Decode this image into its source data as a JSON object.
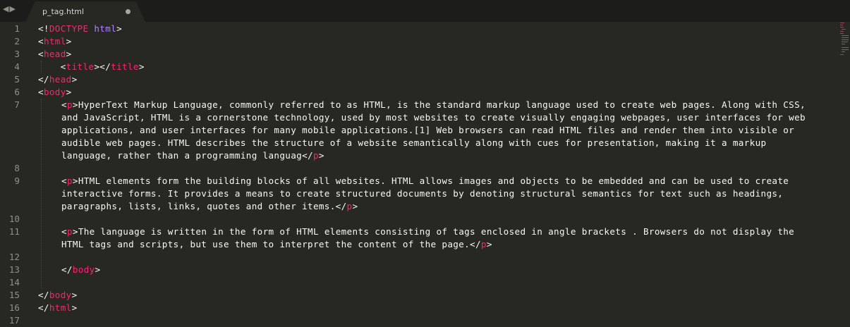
{
  "tab": {
    "title": "p_tag.html",
    "dirty": true
  },
  "nav": {
    "back": "◀",
    "forward": "▶"
  },
  "gutter_numbers": [
    "1",
    "2",
    "3",
    "4",
    "5",
    "6",
    "7",
    "8",
    "9",
    "10",
    "11",
    "12",
    "13",
    "14",
    "15",
    "16",
    "17"
  ],
  "code": {
    "l1": {
      "lt": "<!",
      "kw1": "DOCTYPE",
      "sp": " ",
      "kw2": "html",
      "gt": ">"
    },
    "l2": {
      "lt": "<",
      "tag": "html",
      "gt": ">"
    },
    "l3": {
      "lt": "<",
      "tag": "head",
      "gt": ">"
    },
    "l4": {
      "indent": "    ",
      "lt1": "<",
      "tag1": "title",
      "mid": "></",
      "tag2": "title",
      "gt": ">"
    },
    "l5": {
      "lt": "</",
      "tag": "head",
      "gt": ">"
    },
    "l6": {
      "lt": "<",
      "tag": "body",
      "gt": ">"
    },
    "p1": {
      "open_tag": "p",
      "w1": "HyperText Markup Language, commonly referred to as HTML, is the standard markup language used to create web pages. Along with CSS,",
      "w2": "and JavaScript, HTML is a cornerstone technology, used by most websites to create visually engaging webpages, user interfaces for web",
      "w3": "applications, and user interfaces for many mobile applications.[1] Web browsers can read HTML files and render them into visible or",
      "w4": "audible web pages. HTML describes the structure of a website semantically along with cues for presentation, making it a markup",
      "w5": "language, rather than a programming languag",
      "close_tag": "p"
    },
    "p2": {
      "open_tag": "p",
      "w1": "HTML elements form the building blocks of all websites. HTML allows images and objects to be embedded and can be used to create",
      "w2": "interactive forms. It provides a means to create structured documents by denoting structural semantics for text such as headings,",
      "w3": "paragraphs, lists, links, quotes and other items.",
      "close_tag": "p"
    },
    "p3": {
      "open_tag": "p",
      "w1": "The language is written in the form of HTML elements consisting of tags enclosed in angle brackets . Browsers do not display the",
      "w2": "HTML tags and scripts, but use them to interpret the content of the page.",
      "close_tag": "p"
    },
    "l13": {
      "lt": "</",
      "tag": "body",
      "gt": ">"
    },
    "l15": {
      "lt": "</",
      "tag": "body",
      "gt": ">"
    },
    "l16": {
      "lt": "</",
      "tag": "html",
      "gt": ">"
    }
  },
  "colors": {
    "background": "#272822",
    "tag": "#f92672",
    "keyword": "#ae81ff",
    "text": "#f8f8f2",
    "line_number": "#90908a"
  }
}
